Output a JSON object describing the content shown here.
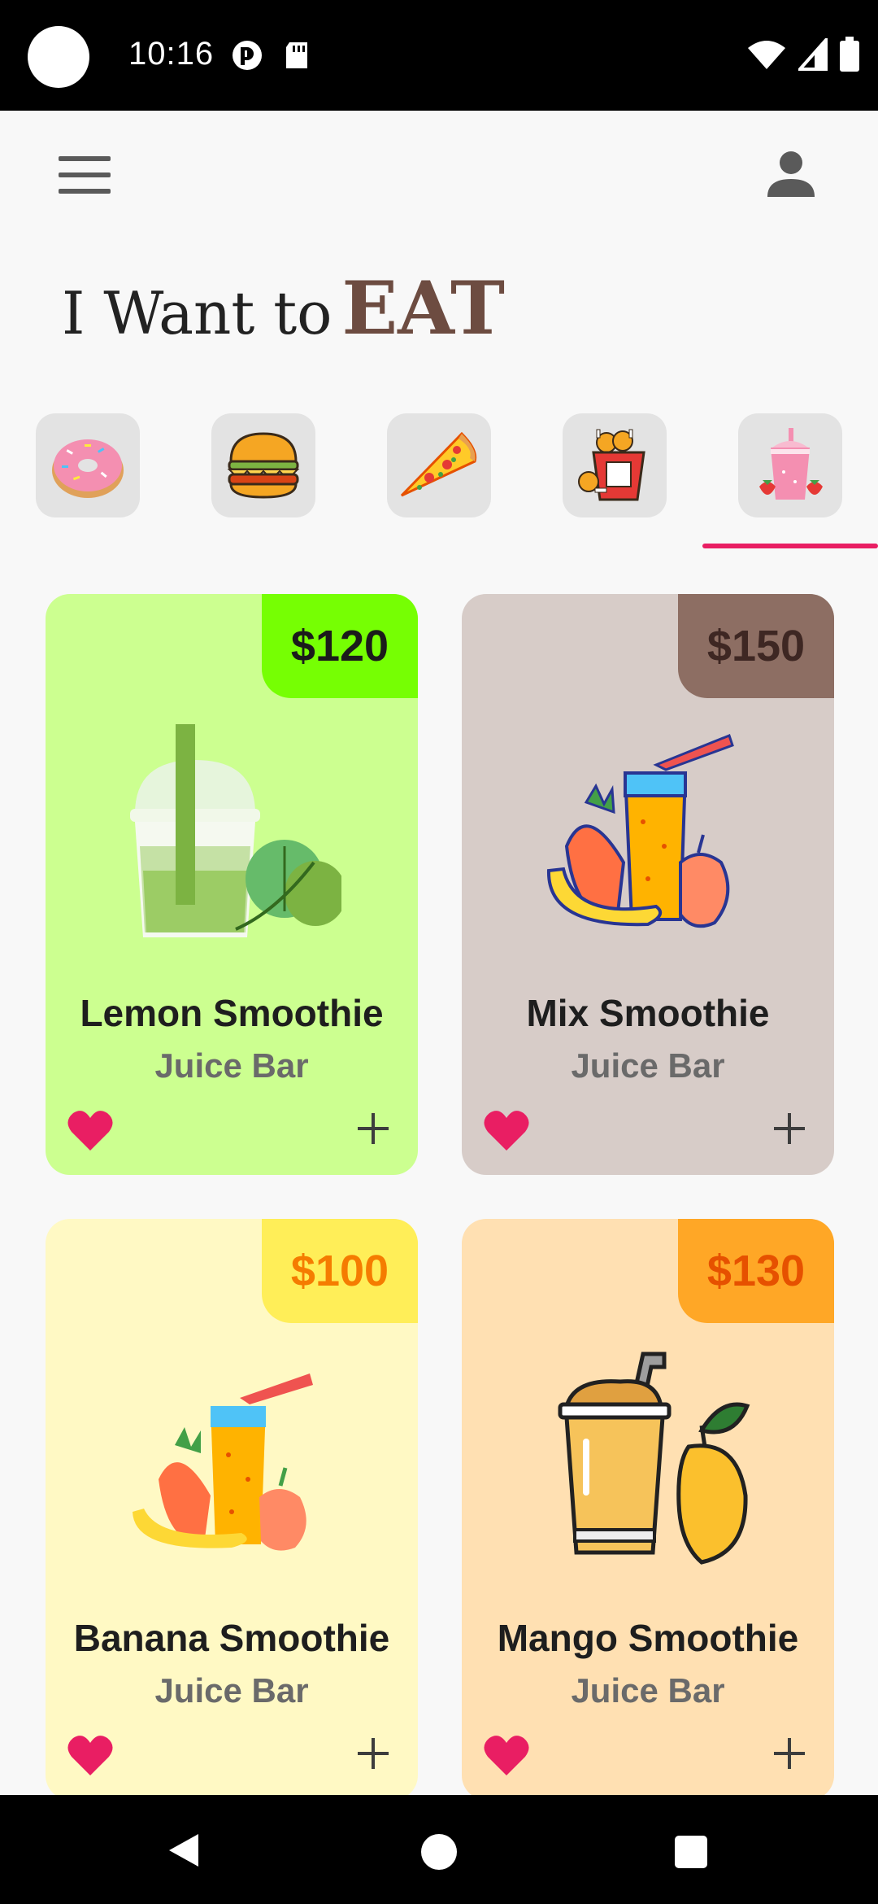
{
  "status_bar": {
    "time": "10:16"
  },
  "header": {
    "title_prefix": "I Want to",
    "title_highlight": "EAT"
  },
  "categories": [
    {
      "name": "donut-icon",
      "selected": false
    },
    {
      "name": "burger-icon",
      "selected": false
    },
    {
      "name": "pizza-icon",
      "selected": false
    },
    {
      "name": "fried-chicken-icon",
      "selected": false
    },
    {
      "name": "smoothie-icon",
      "selected": true
    }
  ],
  "products": [
    {
      "name": "Lemon Smoothie",
      "vendor": "Juice Bar",
      "price": "$120",
      "card_color": "#ccff90",
      "price_bg": "#76ff03",
      "price_color": "#1b1b1b",
      "icon": "lemon-smoothie-icon"
    },
    {
      "name": "Mix Smoothie",
      "vendor": "Juice Bar",
      "price": "$150",
      "card_color": "#d7ccc8",
      "price_bg": "#8d6e63",
      "price_color": "#3e2723",
      "icon": "mix-smoothie-icon"
    },
    {
      "name": "Banana Smoothie",
      "vendor": "Juice Bar",
      "price": "$100",
      "card_color": "#fff9c4",
      "price_bg": "#ffee58",
      "price_color": "#f57c00",
      "icon": "banana-smoothie-icon"
    },
    {
      "name": "Mango Smoothie",
      "vendor": "Juice Bar",
      "price": "$130",
      "card_color": "#ffe0b2",
      "price_bg": "#ffa726",
      "price_color": "#e65100",
      "icon": "mango-smoothie-icon"
    }
  ],
  "colors": {
    "accent": "#e91e63",
    "title_highlight": "#6d4c41",
    "background": "#f8f8f8"
  }
}
